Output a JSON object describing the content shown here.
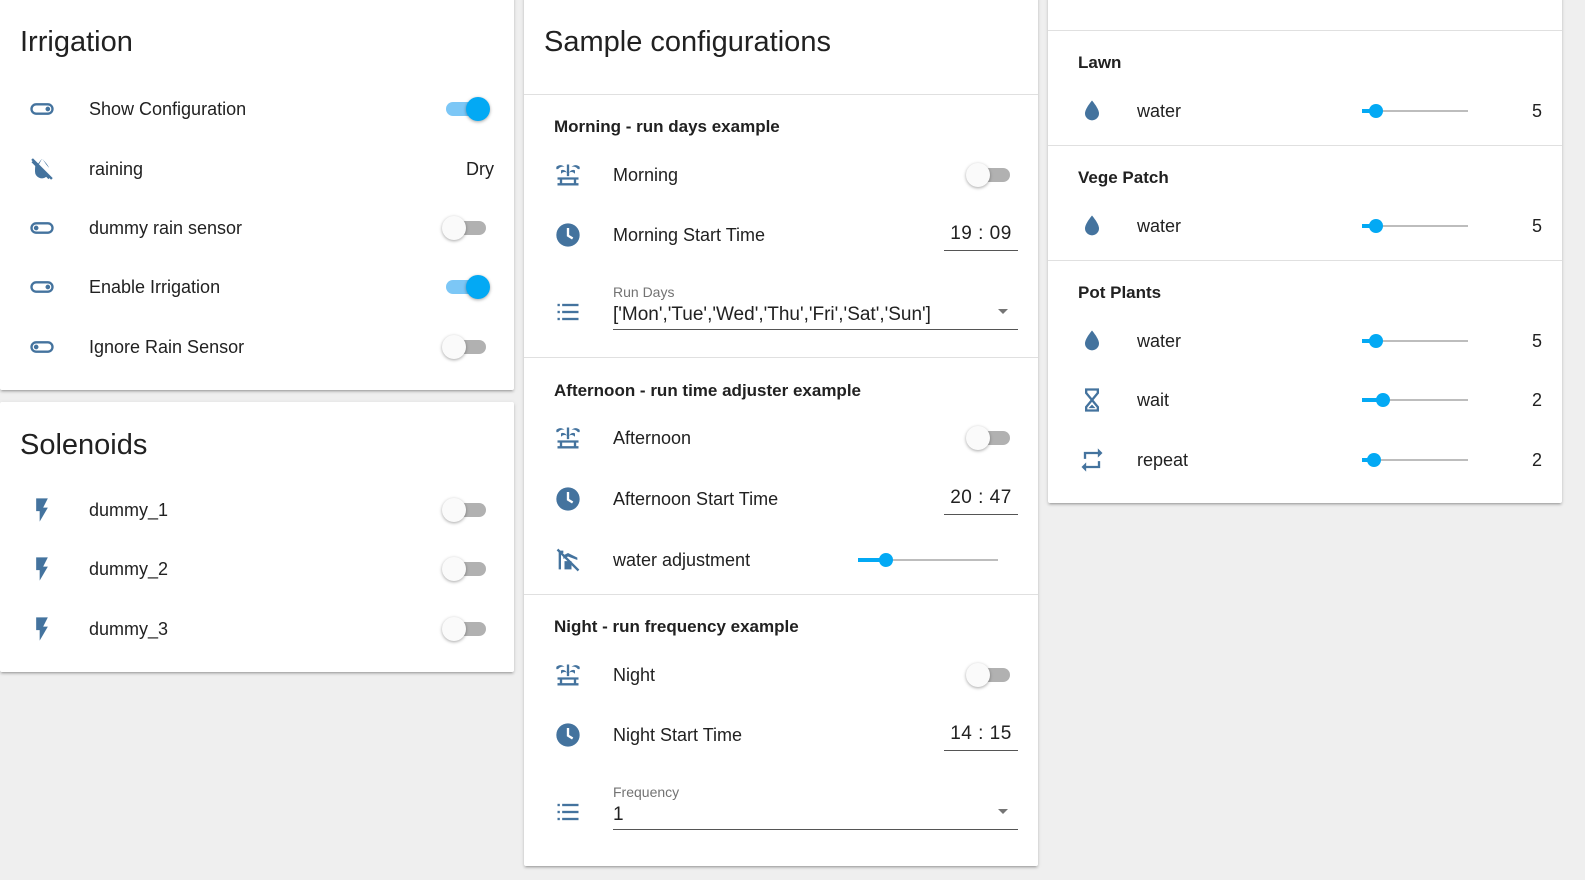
{
  "colors": {
    "icon": "#44739e",
    "accent": "#03a9f4",
    "toggle_on_track": "#7cc7f6"
  },
  "irrigation": {
    "title": "Irrigation",
    "rows": [
      {
        "icon": "toggle-switch-icon",
        "label": "Show Configuration",
        "state": "on"
      },
      {
        "icon": "weather-rain-off-icon",
        "label": "raining",
        "value": "Dry"
      },
      {
        "icon": "toggle-switch-icon",
        "label": "dummy rain sensor",
        "state": "off"
      },
      {
        "icon": "toggle-switch-icon",
        "label": "Enable Irrigation",
        "state": "on"
      },
      {
        "icon": "toggle-switch-icon",
        "label": "Ignore Rain Sensor",
        "state": "off"
      }
    ]
  },
  "solenoids": {
    "title": "Solenoids",
    "rows": [
      {
        "icon": "flash-icon",
        "label": "dummy_1",
        "state": "off"
      },
      {
        "icon": "flash-icon",
        "label": "dummy_2",
        "state": "off"
      },
      {
        "icon": "flash-icon",
        "label": "dummy_3",
        "state": "off"
      }
    ]
  },
  "samples": {
    "title": "Sample configurations",
    "morning": {
      "header": "Morning - run days example",
      "switch_label": "Morning",
      "switch_state": "off",
      "start_label": "Morning Start Time",
      "start_time": "19 : 09",
      "dropdown_label": "Run Days",
      "dropdown_value": "['Mon','Tue','Wed','Thu','Fri','Sat','Sun']"
    },
    "afternoon": {
      "header": "Afternoon - run time adjuster example",
      "switch_label": "Afternoon",
      "switch_state": "off",
      "start_label": "Afternoon Start Time",
      "start_time": "20 : 47",
      "adjust_label": "water adjustment",
      "adjust_fraction": 0.2
    },
    "night": {
      "header": "Night - run frequency example",
      "switch_label": "Night",
      "switch_state": "off",
      "start_label": "Night Start Time",
      "start_time": "14 : 15",
      "dropdown_label": "Frequency",
      "dropdown_value": "1"
    }
  },
  "zones": {
    "lawn": {
      "title": "Lawn",
      "rows": [
        {
          "icon": "water-icon",
          "label": "water",
          "value": "5",
          "fraction": 0.13
        }
      ]
    },
    "vege": {
      "title": "Vege Patch",
      "rows": [
        {
          "icon": "water-icon",
          "label": "water",
          "value": "5",
          "fraction": 0.13
        }
      ]
    },
    "pot": {
      "title": "Pot Plants",
      "rows": [
        {
          "icon": "water-icon",
          "label": "water",
          "value": "5",
          "fraction": 0.13
        },
        {
          "icon": "timer-sand-icon",
          "label": "wait",
          "value": "2",
          "fraction": 0.2
        },
        {
          "icon": "repeat-icon",
          "label": "repeat",
          "value": "2",
          "fraction": 0.11
        }
      ]
    }
  }
}
